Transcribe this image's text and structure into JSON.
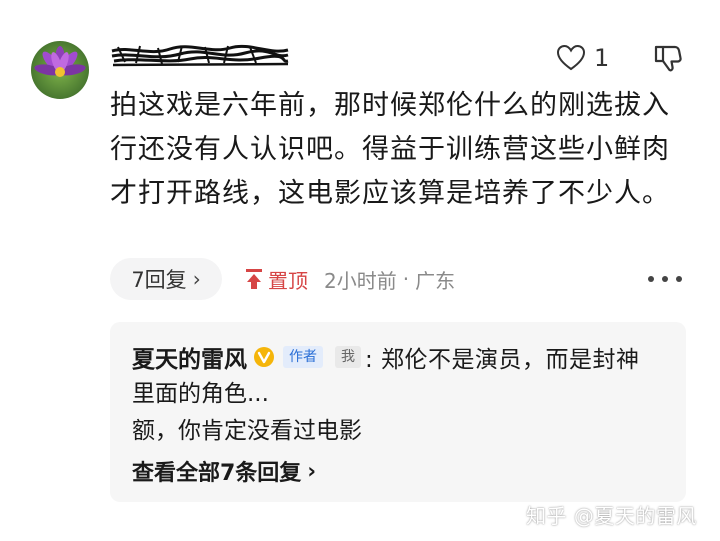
{
  "comment": {
    "like_count": "1",
    "text": "拍这戏是六年前，那时候郑伦什么的刚选拔入行还没有人认识吧。得益于训练营这些小鲜肉才打开路线，这电影应该算是培养了不少人。",
    "reply_count_label": "7回复",
    "pinned_label": "置顶",
    "time": "2小时前",
    "location": "广东"
  },
  "reply_preview": {
    "author": "夏天的雷风",
    "author_tag": "作者",
    "me_tag": "我",
    "text_line1": ": 郑伦不是演员，而是封神",
    "text_line2": "里面的角色...",
    "text_line3": "额，你肯定没看过电影",
    "view_all_label": "查看全部7条回复"
  },
  "watermark": "知乎 @夏天的雷风",
  "colors": {
    "pin_red": "#d64545",
    "author_tag_blue": "#2b6fd6",
    "verified_yellow": "#f5b50a",
    "meta_gray": "#8a8a8a",
    "reply_bg": "#f6f6f6"
  },
  "icons": {
    "like": "heart-icon",
    "dislike": "thumbs-down-icon",
    "pin": "pin-icon",
    "more": "more-icon",
    "verified": "verified-badge-icon"
  }
}
